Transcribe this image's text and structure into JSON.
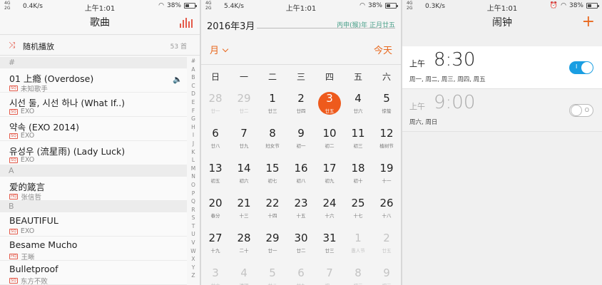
{
  "music": {
    "status": {
      "net_top": "4G",
      "net_bottom": "2G",
      "speed": "0.4K/s",
      "time": "上午1:01",
      "battery": "38%",
      "battery_level": 0.38
    },
    "title": "歌曲",
    "shuffle_label": "随机播放",
    "shuffle_count": "53 首",
    "list": [
      {
        "type": "header",
        "label": "#"
      },
      {
        "type": "song",
        "title": "01 上瘾 (Overdose)",
        "badge": "SQ",
        "artist": "未知歌手",
        "playing": true
      },
      {
        "type": "song",
        "title": "시선 둘, 시선 하나 (What If..)",
        "badge": "SQ",
        "artist": "EXO"
      },
      {
        "type": "song",
        "title": "약속 (EXO 2014)",
        "badge": "SQ",
        "artist": "EXO"
      },
      {
        "type": "song",
        "title": "유성우 (流星雨) (Lady Luck)",
        "badge": "SQ",
        "artist": "EXO"
      },
      {
        "type": "header",
        "label": "A"
      },
      {
        "type": "song",
        "title": "爱的箴言",
        "badge": "HQ",
        "artist": "张信哲"
      },
      {
        "type": "header",
        "label": "B"
      },
      {
        "type": "song",
        "title": "BEAUTIFUL",
        "badge": "SQ",
        "artist": "EXO"
      },
      {
        "type": "song",
        "title": "Besame Mucho",
        "badge": "HQ",
        "artist": "王晰"
      },
      {
        "type": "song",
        "title": "Bulletproof",
        "badge": "SQ",
        "artist": "东方不败"
      }
    ],
    "alphabet": [
      "#",
      "A",
      "B",
      "C",
      "D",
      "E",
      "F",
      "G",
      "H",
      "I",
      "J",
      "K",
      "L",
      "M",
      "N",
      "O",
      "P",
      "Q",
      "R",
      "S",
      "T",
      "U",
      "V",
      "W",
      "X",
      "Y",
      "Z"
    ]
  },
  "calendar": {
    "status": {
      "net_top": "4G",
      "net_bottom": "2G",
      "speed": "5.4K/s",
      "time": "上午1:01",
      "battery": "38%",
      "battery_level": 0.38
    },
    "title": "2016年3月",
    "lunar_header": "丙申(猴)年 正月廿五",
    "month_button": "月",
    "today_button": "今天",
    "weekdays": [
      "日",
      "一",
      "二",
      "三",
      "四",
      "五",
      "六"
    ],
    "days": [
      {
        "n": "28",
        "l": "廿一",
        "dim": true
      },
      {
        "n": "29",
        "l": "廿二",
        "dim": true
      },
      {
        "n": "1",
        "l": "廿三"
      },
      {
        "n": "2",
        "l": "廿四"
      },
      {
        "n": "3",
        "l": "廿五",
        "today": true
      },
      {
        "n": "4",
        "l": "廿六"
      },
      {
        "n": "5",
        "l": "惊蛰"
      },
      {
        "n": "6",
        "l": "廿八"
      },
      {
        "n": "7",
        "l": "廿九"
      },
      {
        "n": "8",
        "l": "妇女节"
      },
      {
        "n": "9",
        "l": "初一"
      },
      {
        "n": "10",
        "l": "初二"
      },
      {
        "n": "11",
        "l": "初三"
      },
      {
        "n": "12",
        "l": "植树节"
      },
      {
        "n": "13",
        "l": "初五"
      },
      {
        "n": "14",
        "l": "初六"
      },
      {
        "n": "15",
        "l": "初七"
      },
      {
        "n": "16",
        "l": "初八"
      },
      {
        "n": "17",
        "l": "初九"
      },
      {
        "n": "18",
        "l": "初十"
      },
      {
        "n": "19",
        "l": "十一"
      },
      {
        "n": "20",
        "l": "春分"
      },
      {
        "n": "21",
        "l": "十三"
      },
      {
        "n": "22",
        "l": "十四"
      },
      {
        "n": "23",
        "l": "十五"
      },
      {
        "n": "24",
        "l": "十六"
      },
      {
        "n": "25",
        "l": "十七"
      },
      {
        "n": "26",
        "l": "十八"
      },
      {
        "n": "27",
        "l": "十九"
      },
      {
        "n": "28",
        "l": "二十"
      },
      {
        "n": "29",
        "l": "廿一"
      },
      {
        "n": "30",
        "l": "廿二"
      },
      {
        "n": "31",
        "l": "廿三"
      },
      {
        "n": "1",
        "l": "愚人节",
        "dim": true
      },
      {
        "n": "2",
        "l": "廿五",
        "dim": true
      },
      {
        "n": "3",
        "l": "廿六",
        "dim": true
      },
      {
        "n": "4",
        "l": "清明",
        "dim": true
      },
      {
        "n": "5",
        "l": "廿八",
        "dim": true
      },
      {
        "n": "6",
        "l": "廿九",
        "dim": true
      },
      {
        "n": "7",
        "l": "初一",
        "dim": true
      },
      {
        "n": "8",
        "l": "初二",
        "dim": true
      },
      {
        "n": "9",
        "l": "初三",
        "dim": true
      }
    ]
  },
  "alarms": {
    "status": {
      "net_top": "4G",
      "net_bottom": "2G",
      "speed": "0.3K/s",
      "time": "上午1:01",
      "battery": "38%",
      "battery_level": 0.38
    },
    "title": "闹钟",
    "items": [
      {
        "ampm": "上午",
        "time": "8:30",
        "days": "周一, 周二, 周三, 周四, 周五",
        "on": true,
        "mark": "I"
      },
      {
        "ampm": "上午",
        "time": "9:00",
        "days": "周六, 周日",
        "on": false,
        "mark": "O"
      }
    ]
  }
}
